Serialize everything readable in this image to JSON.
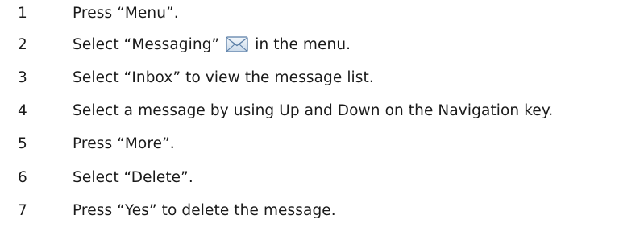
{
  "steps": [
    {
      "number": "1",
      "text": "Press “Menu”."
    },
    {
      "number": "2",
      "text_before": "Select “Messaging”",
      "icon": "envelope-icon",
      "text_after": "in the menu."
    },
    {
      "number": "3",
      "text": "Select “Inbox” to view the message list."
    },
    {
      "number": "4",
      "text": "Select a message by using Up and Down on the Navigation key."
    },
    {
      "number": "5",
      "text": "Press “More”."
    },
    {
      "number": "6",
      "text": "Select “Delete”."
    },
    {
      "number": "7",
      "text": "Press “Yes” to delete the message."
    }
  ]
}
